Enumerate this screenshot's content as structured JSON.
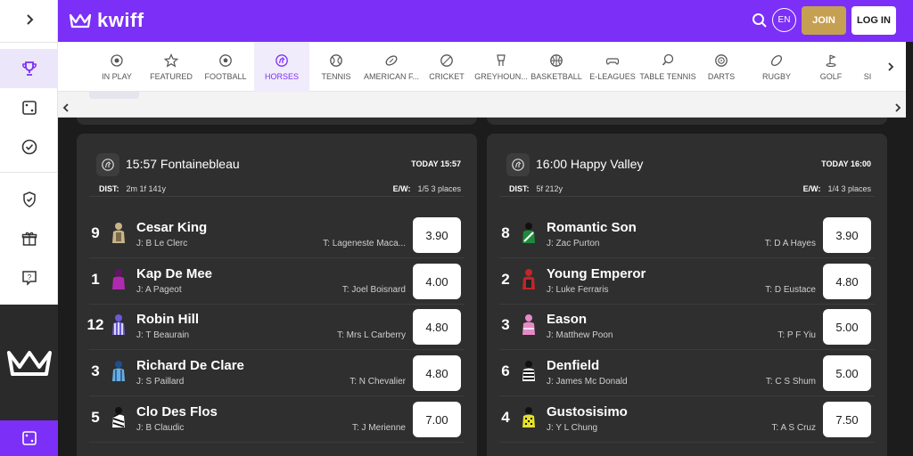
{
  "brand": {
    "name": "kwiff",
    "accent": "#7b2ff7",
    "gold": "#c6a052"
  },
  "header": {
    "lang": "EN",
    "join_label": "JOIN",
    "login_label": "LOG IN"
  },
  "rail": {
    "items": [
      "expand-icon",
      "trophy-icon",
      "dice-icon",
      "check-circle-icon",
      "shield-check-icon",
      "gift-icon",
      "help-chat-icon",
      "kwiff-crown-icon",
      "dice-icon"
    ]
  },
  "sports": [
    {
      "label": "IN PLAY",
      "icon": "in-play-icon"
    },
    {
      "label": "FEATURED",
      "icon": "star-icon"
    },
    {
      "label": "FOOTBALL",
      "icon": "football-icon"
    },
    {
      "label": "HORSES",
      "icon": "horse-icon",
      "active": true
    },
    {
      "label": "TENNIS",
      "icon": "tennis-icon"
    },
    {
      "label": "AMERICAN F...",
      "icon": "american-football-icon"
    },
    {
      "label": "CRICKET",
      "icon": "cricket-icon"
    },
    {
      "label": "GREYHOUN...",
      "icon": "greyhound-icon"
    },
    {
      "label": "BASKETBALL",
      "icon": "basketball-icon"
    },
    {
      "label": "E-LEAGUES",
      "icon": "gamepad-icon"
    },
    {
      "label": "TABLE TENNIS",
      "icon": "table-tennis-icon"
    },
    {
      "label": "DARTS",
      "icon": "darts-icon"
    },
    {
      "label": "RUGBY",
      "icon": "rugby-icon"
    },
    {
      "label": "GOLF",
      "icon": "golf-icon"
    },
    {
      "label": "SI",
      "icon": "snooker-icon"
    }
  ],
  "races": [
    {
      "title": "15:57 Fontainebleau",
      "time": "TODAY 15:57",
      "dist_label": "DIST:",
      "dist": "2m 1f 141y",
      "ew_label": "E/W:",
      "ew": "1/5 3 places",
      "runners": [
        {
          "num": "9",
          "name": "Cesar King",
          "jockey": "J: B Le Clerc",
          "trainer": "T: Lageneste Maca...",
          "odds": "3.90",
          "silk": [
            "#c9b48a",
            "#7a6a4a"
          ]
        },
        {
          "num": "1",
          "name": "Kap De Mee",
          "jockey": "J: A Pageot",
          "trainer": "T: Joel Boisnard",
          "odds": "4.00",
          "silk": [
            "#b02ab0",
            "#6a0f6a"
          ]
        },
        {
          "num": "12",
          "name": "Robin Hill",
          "jockey": "J: T Beaurain",
          "trainer": "T: Mrs L Carberry",
          "odds": "4.80",
          "silk": [
            "#6a5ad8",
            "#ffffff"
          ]
        },
        {
          "num": "3",
          "name": "Richard De Clare",
          "jockey": "J: S Paillard",
          "trainer": "T: N Chevalier",
          "odds": "4.80",
          "silk": [
            "#6aaee0",
            "#1d4f8a"
          ]
        },
        {
          "num": "5",
          "name": "Clo Des Flos",
          "jockey": "J: B Claudic",
          "trainer": "T: J Merienne",
          "odds": "7.00",
          "silk": [
            "#ffffff",
            "#111111"
          ]
        }
      ]
    },
    {
      "title": "16:00 Happy Valley",
      "time": "TODAY 16:00",
      "dist_label": "DIST:",
      "dist": "5f 212y",
      "ew_label": "E/W:",
      "ew": "1/4 3 places",
      "runners": [
        {
          "num": "8",
          "name": "Romantic Son",
          "jockey": "J: Zac Purton",
          "trainer": "T: D A Hayes",
          "odds": "3.90",
          "silk": [
            "#1c8a3a",
            "#ffffff"
          ]
        },
        {
          "num": "2",
          "name": "Young Emperor",
          "jockey": "J: Luke Ferraris",
          "trainer": "T: D Eustace",
          "odds": "4.80",
          "silk": [
            "#c0262b",
            "#222222"
          ]
        },
        {
          "num": "3",
          "name": "Eason",
          "jockey": "J: Matthew Poon",
          "trainer": "T: P F Yiu",
          "odds": "5.00",
          "silk": [
            "#e58ac8",
            "#ffffff"
          ]
        },
        {
          "num": "6",
          "name": "Denfield",
          "jockey": "J: James Mc Donald",
          "trainer": "T: C S Shum",
          "odds": "5.00",
          "silk": [
            "#ffffff",
            "#111111"
          ]
        },
        {
          "num": "4",
          "name": "Gustosisimo",
          "jockey": "J: Y L Chung",
          "trainer": "T: A S Cruz",
          "odds": "7.50",
          "silk": [
            "#e6e02a",
            "#111111"
          ]
        }
      ]
    }
  ]
}
